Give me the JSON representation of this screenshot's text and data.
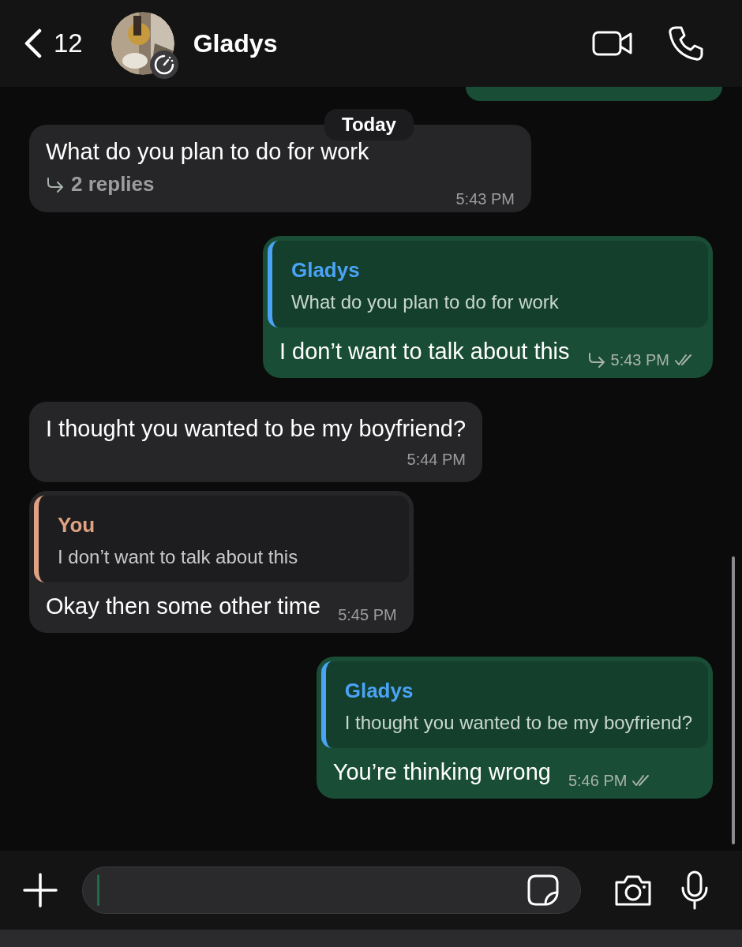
{
  "header": {
    "back_count": "12",
    "contact_name": "Gladys",
    "disappearing_timer": true
  },
  "date_chip": "Today",
  "messages": [
    {
      "kind": "incoming",
      "text": "What do you plan to do for work",
      "replies": "2 replies",
      "time": "5:43 PM"
    },
    {
      "kind": "outgoing",
      "quote": {
        "author": "Gladys",
        "text": "What do you plan to do for work",
        "color": "#4aa3f5"
      },
      "text": "I don’t want to talk about this",
      "is_reply": true,
      "time": "5:43 PM",
      "read": true
    },
    {
      "kind": "incoming",
      "text": "I thought you wanted to be my boyfriend?",
      "time": "5:44 PM"
    },
    {
      "kind": "incoming",
      "quote": {
        "author": "You",
        "text": "I don’t want to talk about this",
        "color": "#e0a282"
      },
      "text": "Okay then some other time",
      "time": "5:45 PM"
    },
    {
      "kind": "outgoing",
      "quote": {
        "author": "Gladys",
        "text": "I thought you wanted to be my boyfriend?",
        "color": "#4aa3f5"
      },
      "text": "You’re thinking wrong",
      "time": "5:46 PM",
      "read": true
    }
  ]
}
